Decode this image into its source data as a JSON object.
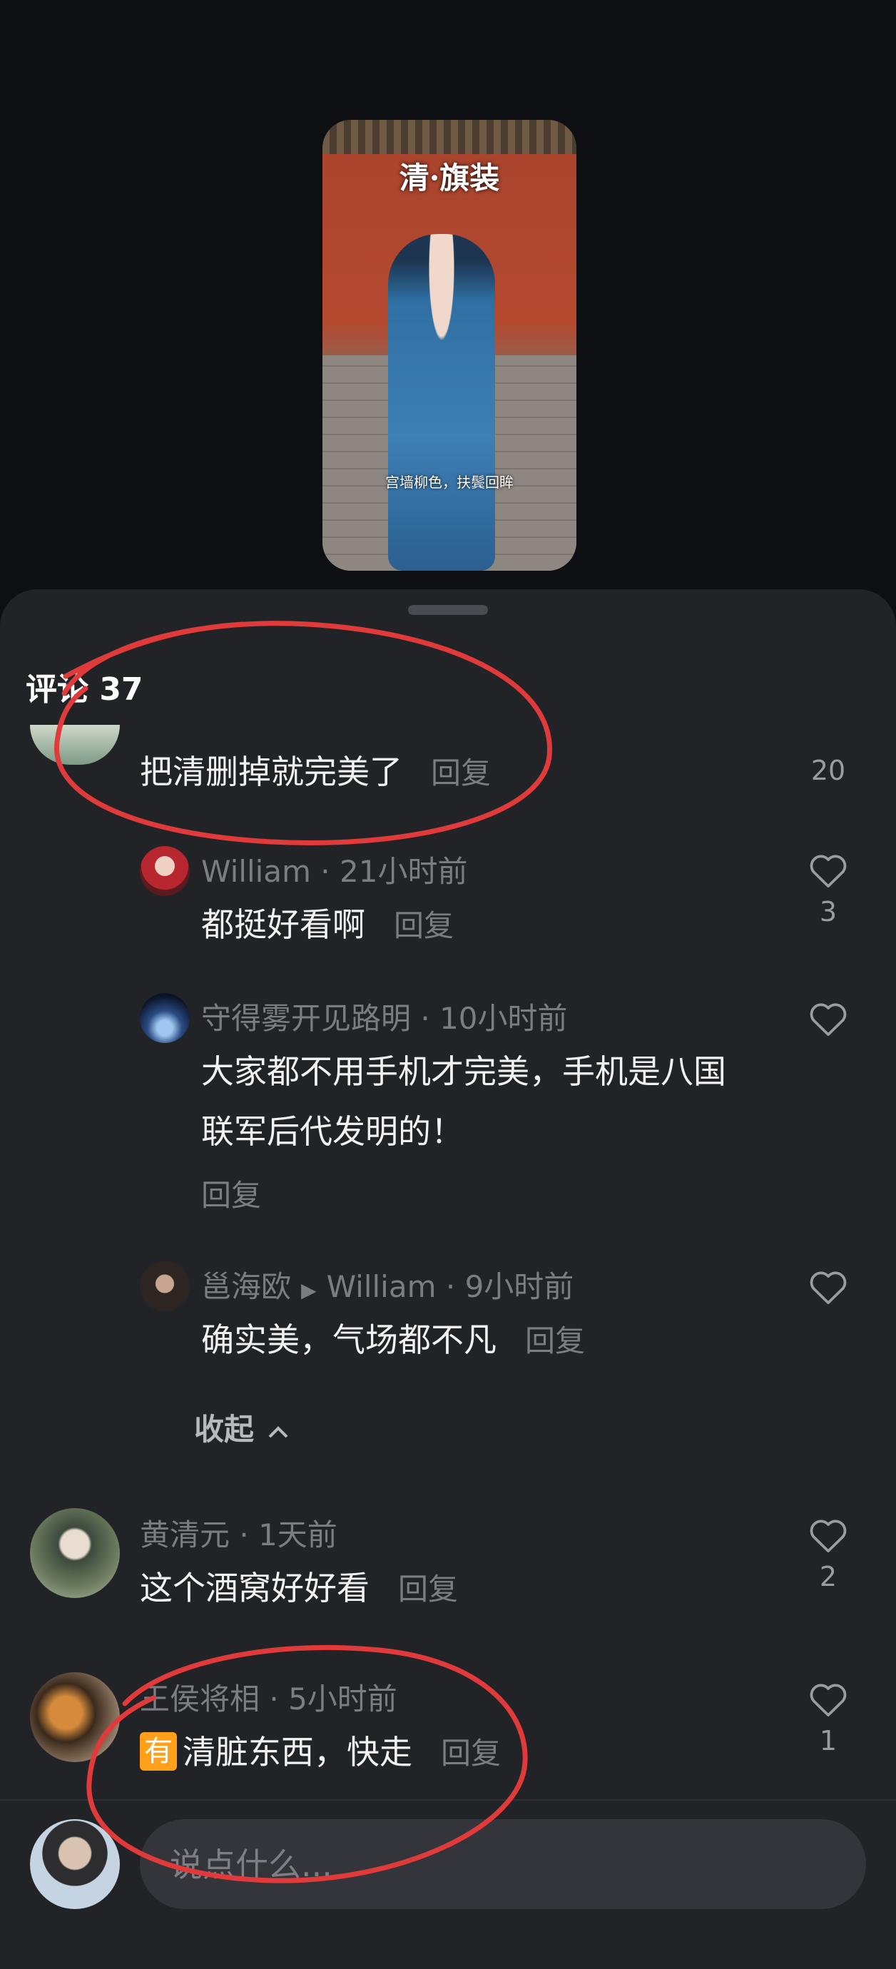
{
  "video": {
    "title": "清·旗装",
    "caption": "宫墙柳色，扶鬓回眸"
  },
  "comments_panel": {
    "title": "评论 37",
    "top_comment": {
      "text": "把清删掉就完美了",
      "reply_label": "回复",
      "likes": "20"
    },
    "replies": [
      {
        "author": "William",
        "time": "21小时前",
        "text": "都挺好看啊",
        "reply_label": "回复",
        "likes": "3"
      },
      {
        "author": "守得雾开见路明",
        "time": "10小时前",
        "text_line1": "大家都不用手机才完美，手机是八国",
        "text_line2": "联军后代发明的！",
        "reply_label": "回复"
      },
      {
        "author": "邕海欧",
        "reply_to": "William",
        "time": "9小时前",
        "text": "确实美，气场都不凡",
        "reply_label": "回复"
      }
    ],
    "collapse_label": "收起",
    "comments": [
      {
        "author": "黄清元",
        "time": "1天前",
        "text": "这个酒窝好好看",
        "reply_label": "回复",
        "likes": "2"
      },
      {
        "author": "王侯将相",
        "time": "5小时前",
        "badge": "有",
        "text": "清脏东西，快走",
        "reply_label": "回复",
        "likes": "1"
      }
    ],
    "input_placeholder": "说点什么..."
  },
  "colors": {
    "sheet_bg": "#222327",
    "annotation_red": "#e03a3a",
    "badge_orange": "#ff9f1a"
  }
}
